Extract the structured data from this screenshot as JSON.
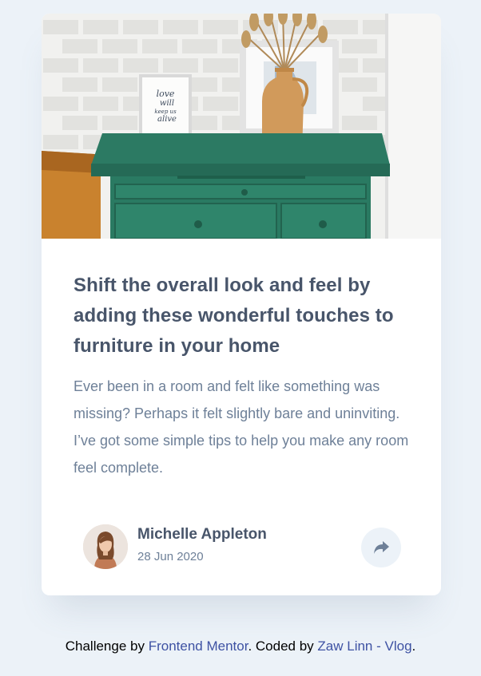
{
  "article": {
    "title": "Shift the overall look and feel by adding these wonderful touches to furniture in your home",
    "description": "Ever been in a room and felt like something was missing? Perhaps it felt slightly bare and uninviting. I’ve got some simple tips to help you make any room feel complete.",
    "hero_image": "drawers-photo",
    "frame_text": [
      "love",
      "will",
      "keep us",
      "alive"
    ]
  },
  "author": {
    "name": "Michelle Appleton",
    "date": "28 Jun 2020",
    "avatar_icon": "avatar-michelle"
  },
  "share": {
    "icon": "share-icon"
  },
  "attribution": {
    "prefix": "Challenge by ",
    "link1": "Frontend Mentor",
    "middle": ". Coded by ",
    "link2": "Zaw Linn - Vlog",
    "suffix": "."
  },
  "colors": {
    "background": "#ecf2f8",
    "title": "#48556a",
    "text": "#6e8098",
    "link": "#3e52a3",
    "dresser": "#2c7a63"
  }
}
